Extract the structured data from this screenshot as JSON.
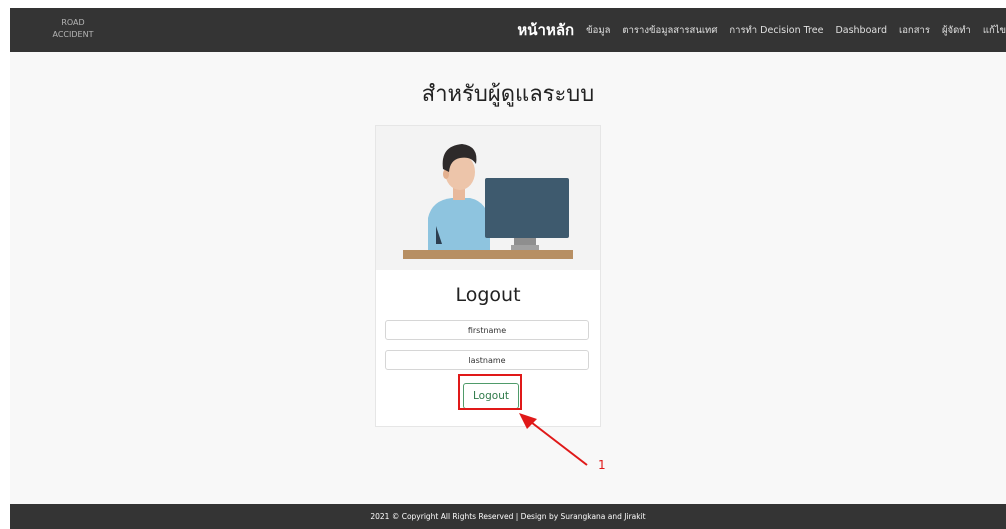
{
  "brand": {
    "line1": "ROAD",
    "line2": "ACCIDENT"
  },
  "nav": {
    "items": [
      {
        "label": "หน้าหลัก",
        "active": true
      },
      {
        "label": "ข้อมูล"
      },
      {
        "label": "ตารางข้อมูลสารสนเทศ"
      },
      {
        "label": "การทำ Decision Tree"
      },
      {
        "label": "Dashboard"
      },
      {
        "label": "เอกสาร"
      },
      {
        "label": "ผู้จัดทำ"
      },
      {
        "label": "แก้ไข"
      }
    ]
  },
  "page": {
    "heading": "สำหรับผู้ดูแลระบบ"
  },
  "card": {
    "illustration_icon": "admin-at-computer-illustration",
    "title": "Logout",
    "firstname_placeholder": "firstname",
    "lastname_placeholder": "lastname",
    "button_label": "Logout"
  },
  "annotation": {
    "number": "1",
    "color": "#e01919"
  },
  "footer": {
    "text": "2021 © Copyright All Rights Reserved | Design by Surangkana and Jirakit"
  },
  "colors": {
    "navbar": "#343434",
    "button_border": "#4f9b6a",
    "button_text": "#2f7a49"
  }
}
